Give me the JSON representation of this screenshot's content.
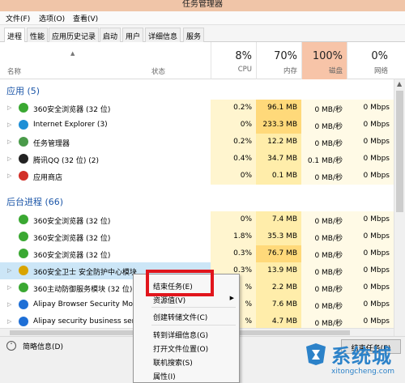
{
  "window": {
    "title": "任务管理器"
  },
  "menu": [
    "文件(F)",
    "选项(O)",
    "查看(V)"
  ],
  "tabs": [
    "进程",
    "性能",
    "应用历史记录",
    "启动",
    "用户",
    "详细信息",
    "服务"
  ],
  "header": {
    "name": "名称",
    "status": "状态",
    "cpu": {
      "percent": "8%",
      "label": "CPU"
    },
    "memory": {
      "percent": "70%",
      "label": "内存"
    },
    "disk": {
      "percent": "100%",
      "label": "磁盘"
    },
    "network": {
      "percent": "0%",
      "label": "网络"
    }
  },
  "sections": {
    "apps": "应用 (5)",
    "background": "后台进程 (66)"
  },
  "apps": [
    {
      "name": "360安全浏览器 (32 位)",
      "cpu": "0.2%",
      "memory": "96.1 MB",
      "disk": "0 MB/秒",
      "network": "0 Mbps",
      "icon_color": "#3aa832"
    },
    {
      "name": "Internet Explorer (3)",
      "cpu": "0%",
      "memory": "233.3 MB",
      "disk": "0 MB/秒",
      "network": "0 Mbps",
      "icon_color": "#1e8fd6"
    },
    {
      "name": "任务管理器",
      "cpu": "0.2%",
      "memory": "12.2 MB",
      "disk": "0 MB/秒",
      "network": "0 Mbps",
      "icon_color": "#4a9a4a"
    },
    {
      "name": "腾讯QQ (32 位) (2)",
      "cpu": "0.4%",
      "memory": "34.7 MB",
      "disk": "0.1 MB/秒",
      "network": "0 Mbps",
      "icon_color": "#222222"
    },
    {
      "name": "应用商店",
      "cpu": "0%",
      "memory": "0.1 MB",
      "disk": "0 MB/秒",
      "network": "0 Mbps",
      "icon_color": "#d22f27"
    }
  ],
  "background": [
    {
      "name": "360安全浏览器 (32 位)",
      "cpu": "0%",
      "memory": "7.4 MB",
      "disk": "0 MB/秒",
      "network": "0 Mbps",
      "icon_color": "#3aa832"
    },
    {
      "name": "360安全浏览器 (32 位)",
      "cpu": "1.8%",
      "memory": "35.3 MB",
      "disk": "0 MB/秒",
      "network": "0 Mbps",
      "icon_color": "#3aa832"
    },
    {
      "name": "360安全浏览器 (32 位)",
      "cpu": "0.3%",
      "memory": "76.7 MB",
      "disk": "0 MB/秒",
      "network": "0 Mbps",
      "icon_color": "#3aa832"
    },
    {
      "name": "360安全卫士 安全防护中心模块",
      "cpu": "0.3%",
      "memory": "13.9 MB",
      "disk": "0 MB/秒",
      "network": "0 Mbps",
      "icon_color": "#d9a400"
    },
    {
      "name": "360主动防御服务模块 (32 位)",
      "cpu": "%",
      "memory": "2.2 MB",
      "disk": "0 MB/秒",
      "network": "0 Mbps",
      "icon_color": "#3aa832"
    },
    {
      "name": "Alipay Browser Security Mo",
      "cpu": "%",
      "memory": "7.6 MB",
      "disk": "0 MB/秒",
      "network": "0 Mbps",
      "icon_color": "#1e6fd6"
    },
    {
      "name": "Alipay security business ser",
      "cpu": "%",
      "memory": "4.7 MB",
      "disk": "0 MB/秒",
      "network": "0 Mbps",
      "icon_color": "#1e6fd6"
    }
  ],
  "footer": {
    "fewer_details": "简略信息(D)",
    "end_task": "结束任务(E)"
  },
  "context_menu": [
    "结束任务(E)",
    "资源值(V)",
    "创建转储文件(C)",
    "转到详细信息(G)",
    "打开文件位置(O)",
    "联机搜索(S)",
    "属性(I)"
  ],
  "watermark": {
    "brand": "系统城",
    "url": "xitongcheng.com"
  }
}
